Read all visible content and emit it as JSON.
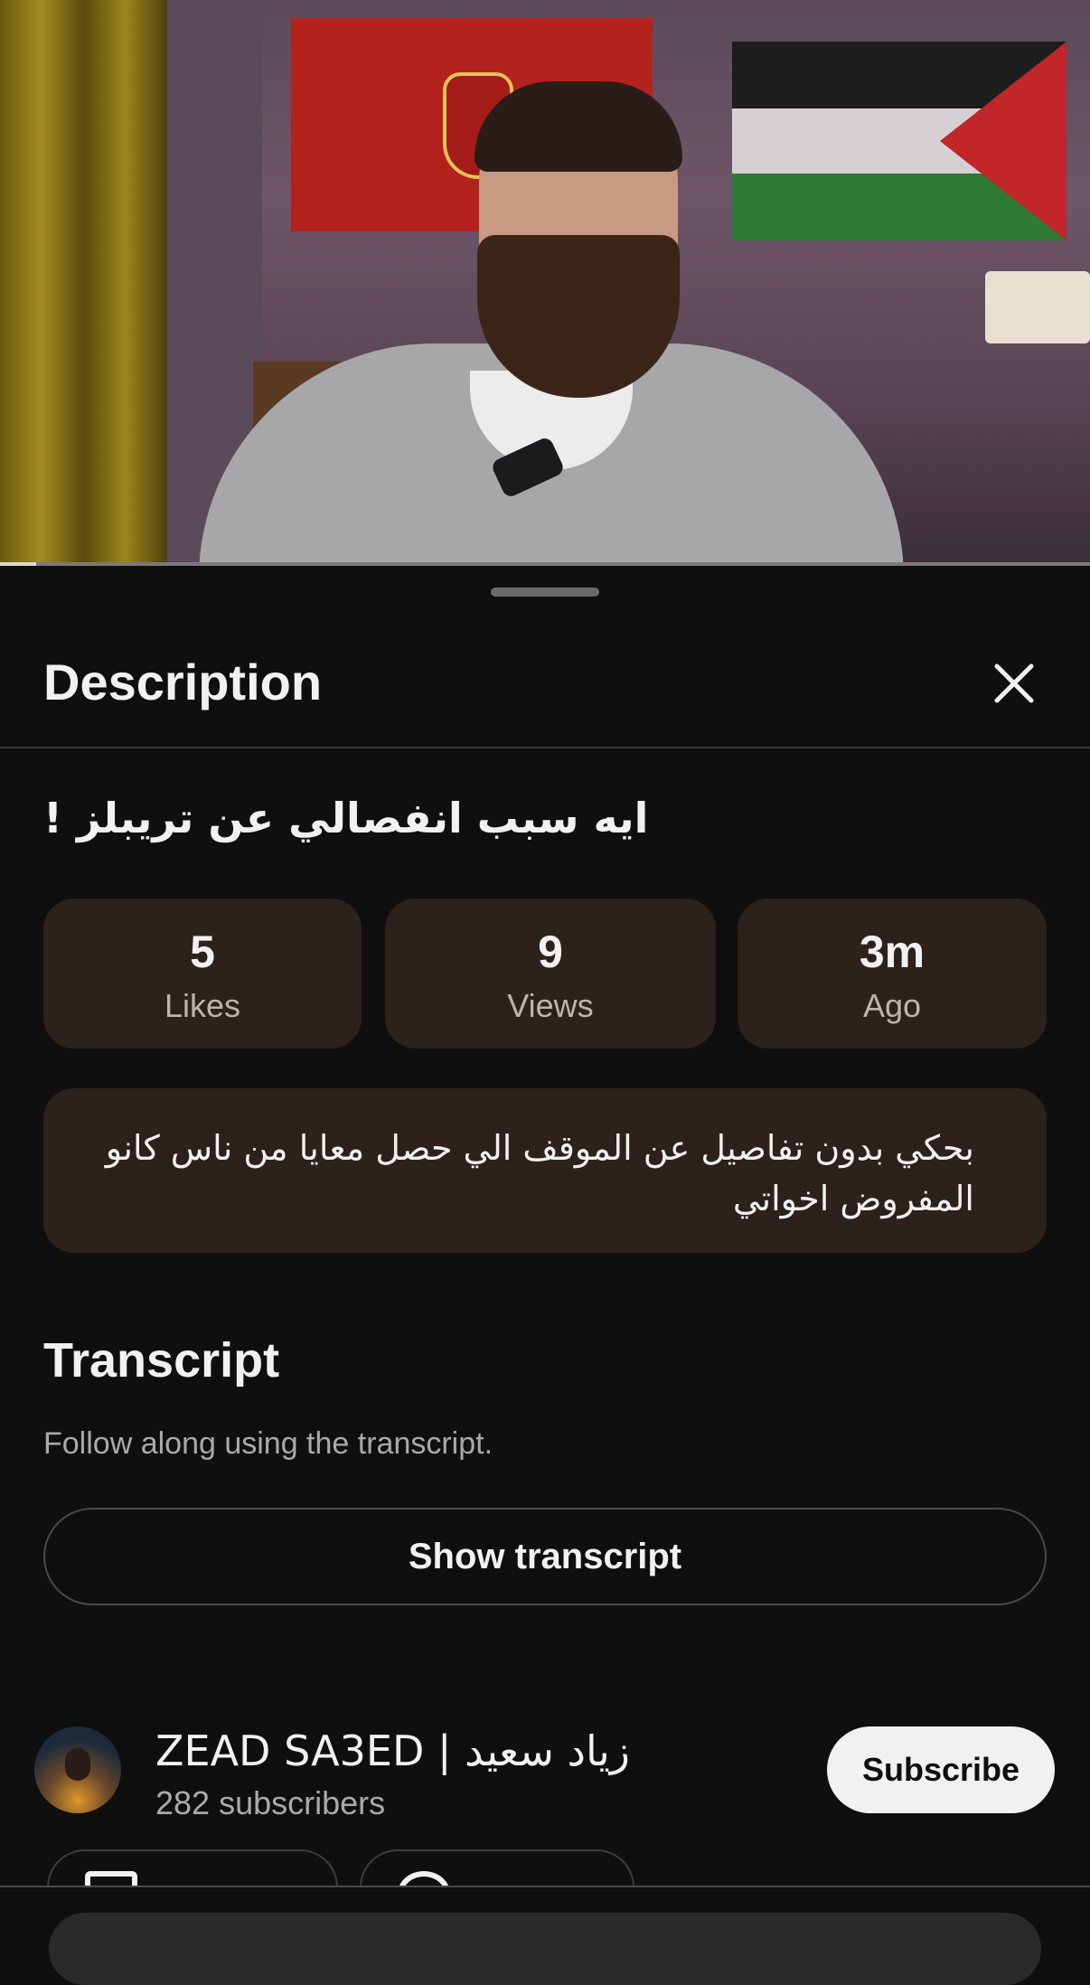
{
  "video": {
    "progress_percent": 3.3
  },
  "sheet": {
    "title": "Description",
    "video_title": "ايه سبب انفصالي عن تريبلز !",
    "stats": [
      {
        "value": "5",
        "label": "Likes"
      },
      {
        "value": "9",
        "label": "Views"
      },
      {
        "value": "3m",
        "label": "Ago"
      }
    ],
    "description": "بحكي بدون تفاصيل عن الموقف الي حصل معايا من ناس كانو المفروض اخواتي",
    "transcript": {
      "heading": "Transcript",
      "subtext": "Follow along using the transcript.",
      "button": "Show transcript"
    },
    "channel": {
      "name": "ZEAD SA3ED | زياد سعيد",
      "subscribers": "282 subscribers",
      "subscribe_label": "Subscribe"
    }
  },
  "colors": {
    "background": "#0f0f0f",
    "stat_card": "#2d211b",
    "subscribe_bg": "#f1f1f1"
  },
  "icons": [
    "close-icon",
    "videos-icon",
    "about-icon"
  ]
}
